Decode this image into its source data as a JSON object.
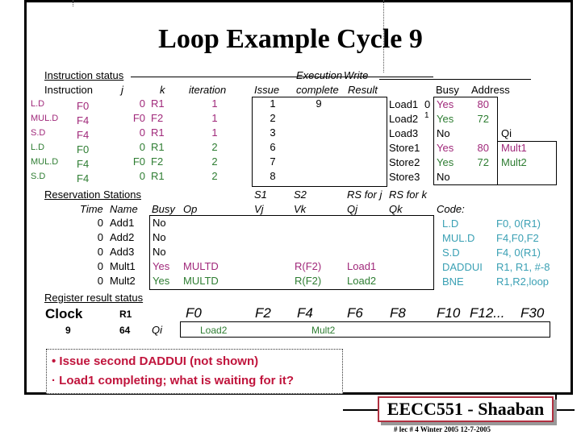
{
  "title": "Loop Example Cycle 9",
  "instruction_status": {
    "section_label": "Instruction status",
    "headers": {
      "instruction": "Instruction",
      "j": "j",
      "k": "k",
      "iteration": "iteration",
      "issue": "Issue",
      "exec_top": "Execution",
      "exec_bottom": "complete",
      "write_top": "Write",
      "write_bottom": "Result"
    },
    "rows": [
      {
        "op": "L.D",
        "dest": "F0",
        "j": "0",
        "k": "R1",
        "iteration": "1",
        "issue": "1",
        "exec": "9",
        "write": "",
        "color": "mag"
      },
      {
        "op": "MUL.D",
        "dest": "F4",
        "j": "F0",
        "k": "F2",
        "iteration": "1",
        "issue": "2",
        "exec": "",
        "write": "",
        "color": "mag"
      },
      {
        "op": "S.D",
        "dest": "F4",
        "j": "0",
        "k": "R1",
        "iteration": "1",
        "issue": "3",
        "exec": "",
        "write": "",
        "color": "mag"
      },
      {
        "op": "L.D",
        "dest": "F0",
        "j": "0",
        "k": "R1",
        "iteration": "2",
        "issue": "6",
        "exec": "",
        "write": "",
        "color": "grn"
      },
      {
        "op": "MUL.D",
        "dest": "F4",
        "j": "F0",
        "k": "F2",
        "iteration": "2",
        "issue": "7",
        "exec": "",
        "write": "",
        "color": "grn"
      },
      {
        "op": "S.D",
        "dest": "F4",
        "j": "0",
        "k": "R1",
        "iteration": "2",
        "issue": "8",
        "exec": "",
        "write": "",
        "color": "grn"
      }
    ]
  },
  "load_store_buffers": {
    "headers": {
      "busy": "Busy",
      "address": "Address",
      "qi": "Qi"
    },
    "rows": [
      {
        "name": "Load1",
        "marker": "0",
        "busy": "Yes",
        "address": "80",
        "qi": "",
        "color": "mag"
      },
      {
        "name": "Load2",
        "marker": "1",
        "busy": "Yes",
        "address": "72",
        "qi": "",
        "color": "grn"
      },
      {
        "name": "Load3",
        "marker": "",
        "busy": "No",
        "address": "",
        "qi": "",
        "color": ""
      },
      {
        "name": "Store1",
        "marker": "",
        "busy": "Yes",
        "address": "80",
        "qi": "Mult1",
        "color": "mag"
      },
      {
        "name": "Store2",
        "marker": "",
        "busy": "Yes",
        "address": "72",
        "qi": "Mult2",
        "color": "grn"
      },
      {
        "name": "Store3",
        "marker": "",
        "busy": "No",
        "address": "",
        "qi": "",
        "color": ""
      }
    ]
  },
  "reservation_stations": {
    "section_label": "Reservation Stations",
    "headers": {
      "time": "Time",
      "name": "Name",
      "busy": "Busy",
      "op": "Op",
      "s1_top": "S1",
      "vj": "Vj",
      "s2_top": "S2",
      "vk": "Vk",
      "rsj_top": "RS for j",
      "qj": "Qj",
      "rsk_top": "RS for k",
      "qk": "Qk"
    },
    "rows": [
      {
        "time": "0",
        "name": "Add1",
        "busy": "No",
        "op": "",
        "vj": "",
        "vk": "",
        "qj": "",
        "qk": "",
        "color": ""
      },
      {
        "time": "0",
        "name": "Add2",
        "busy": "No",
        "op": "",
        "vj": "",
        "vk": "",
        "qj": "",
        "qk": "",
        "color": ""
      },
      {
        "time": "0",
        "name": "Add3",
        "busy": "No",
        "op": "",
        "vj": "",
        "vk": "",
        "qj": "",
        "qk": "",
        "color": ""
      },
      {
        "time": "0",
        "name": "Mult1",
        "busy": "Yes",
        "op": "MULTD",
        "vj": "",
        "vk": "R(F2)",
        "qj": "Load1",
        "qk": "",
        "color": "mag"
      },
      {
        "time": "0",
        "name": "Mult2",
        "busy": "Yes",
        "op": "MULTD",
        "vj": "",
        "vk": "R(F2)",
        "qj": "Load2",
        "qk": "",
        "color": "grn"
      }
    ]
  },
  "code": {
    "label": "Code:",
    "lines": [
      {
        "op": "L.D",
        "args": "F0, 0(R1)"
      },
      {
        "op": "MUL.D",
        "args": "F4,F0,F2"
      },
      {
        "op": "S.D",
        "args": "F4, 0(R1)"
      },
      {
        "op": "DADDUI",
        "args": "R1, R1, #-8"
      },
      {
        "op": "BNE",
        "args": "R1,R2,loop"
      }
    ]
  },
  "register_status": {
    "section_label": "Register result status",
    "clock_label": "Clock",
    "clock_value": "9",
    "r1_label": "R1",
    "r1_value": "64",
    "qi_label": "Qi",
    "registers": [
      "F0",
      "F2",
      "F4",
      "F6",
      "F8",
      "F10",
      "F12...",
      "F30"
    ],
    "qi_values": {
      "F0": "Load2",
      "F4": "Mult2"
    }
  },
  "notes": {
    "line1": "• Issue second DADDUI (not shown)",
    "line2": "· Load1 completing; what is waiting for it?"
  },
  "footer": {
    "brand": "EECC551 - Shaaban",
    "sub": "#  lec # 4  Winter 2005     12-7-2005"
  }
}
